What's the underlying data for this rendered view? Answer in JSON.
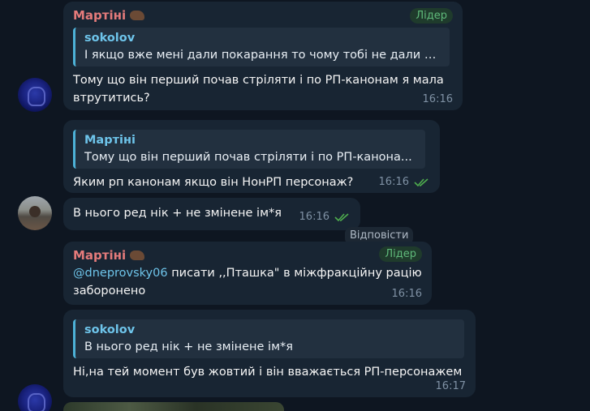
{
  "messages": [
    {
      "sender": "Мартіні",
      "badge": "Лідер",
      "quote_name": "sokolov",
      "quote_text": "І якщо вже мені дали покарання то чому тобі не дали в...",
      "text_line1": "Тому що він перший почав стріляти і по РП-канонам я мала",
      "text_line2": "втрутитись?",
      "time": "16:16"
    },
    {
      "quote_name": "Мартіні",
      "quote_text": "Тому що він перший почав стріляти і по РП-канона...",
      "text": "Яким рп канонам якщо він НонРП персонаж?",
      "time": "16:16"
    },
    {
      "text": "В нього ред нік + не змінене ім*я",
      "time": "16:16"
    },
    {
      "sender": "Мартіні",
      "badge": "Лідер",
      "mention": "@dneprovsky06",
      "text_rest": " писати ,,Пташка\" в міжфракційну рацію",
      "text_line2": "заборонено",
      "time": "16:16"
    },
    {
      "quote_name": "sokolov",
      "quote_text": "В нього ред нік + не змінене ім*я",
      "text": "Ні,на тей момент був жовтий і він вважається РП-персонажем",
      "time": "16:17"
    }
  ],
  "reply_hint": "Відповісти",
  "colors": {
    "background": "#0e1621",
    "bubble": "#182533",
    "sender_name": "#e57b7b",
    "quote_accent": "#4db2d8",
    "badge_text": "#5fb97a",
    "read_ticks": "#4fae4e"
  }
}
